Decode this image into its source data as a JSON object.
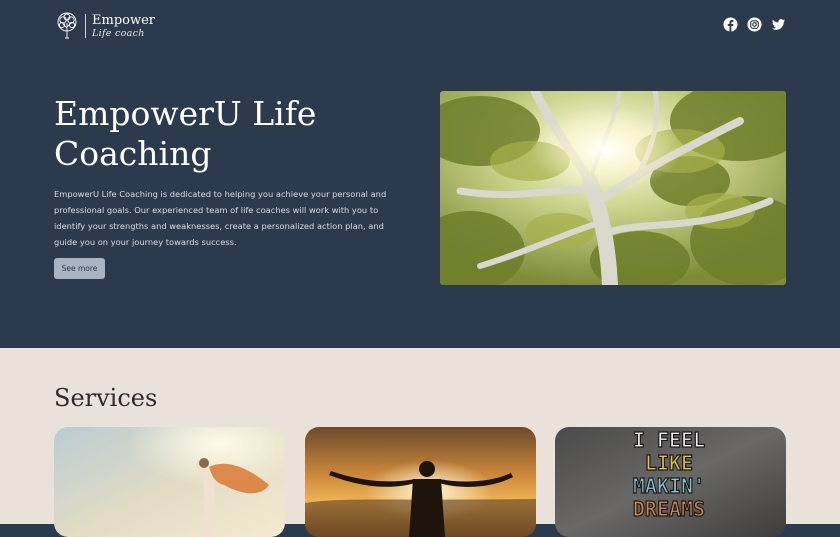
{
  "header": {
    "logo_name": "Empower",
    "logo_tagline": "Life coach",
    "social_icons": [
      "facebook-icon",
      "instagram-icon",
      "twitter-icon"
    ]
  },
  "hero": {
    "title": "EmpowerU Life Coaching",
    "description": "EmpowerU Life Coaching is dedicated to helping you achieve your personal and professional goals. Our experienced team of life coaches will work with you to identify your strengths and weaknesses, create a personalized action plan, and guide you on your journey towards success.",
    "button_label": "See more"
  },
  "services": {
    "title": "Services",
    "cards": [
      {
        "image": "woman-with-scarf-photo"
      },
      {
        "image": "man-arms-raised-sunset-photo"
      },
      {
        "image": "i-feel-like-makin-dreams-photo",
        "image_text": [
          "I FEEL",
          "LIKE",
          "MAKIN'",
          "DREAMS"
        ]
      }
    ]
  },
  "colors": {
    "hero_bg": "#2c3a4e",
    "services_bg": "#e9e1da",
    "button_bg": "#a8b4c2"
  }
}
